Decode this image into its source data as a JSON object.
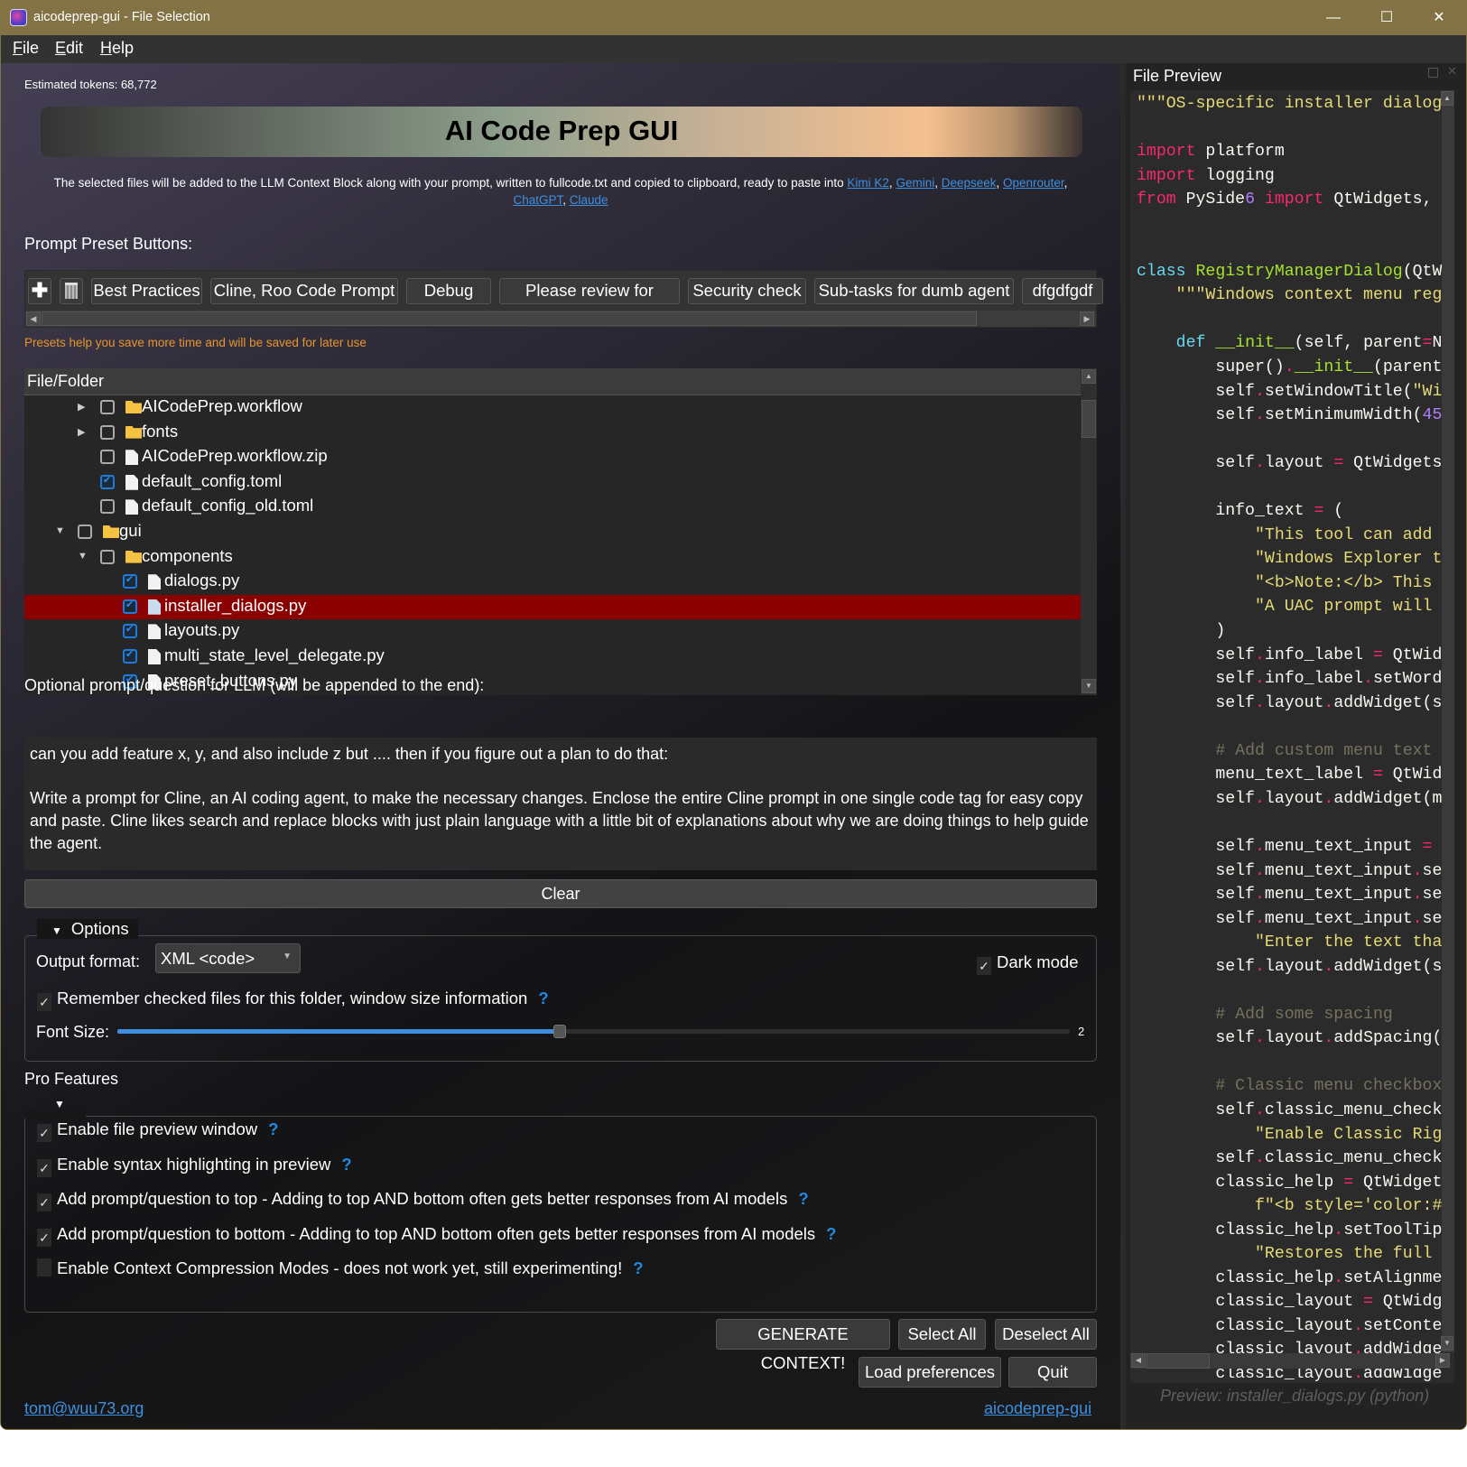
{
  "window": {
    "title": "aicodeprep-gui - File Selection",
    "controls": {
      "minimize": "—",
      "maximize": "☐",
      "close": "✕"
    }
  },
  "menu": [
    {
      "label": "File",
      "mnemonic": "F"
    },
    {
      "label": "Edit",
      "mnemonic": "E"
    },
    {
      "label": "Help",
      "mnemonic": "H"
    }
  ],
  "tokens": "Estimated tokens: 68,772",
  "banner": {
    "title": "AI Code Prep GUI"
  },
  "description": {
    "text": "The selected files will be added to the LLM Context Block along with your prompt, written to fullcode.txt and copied to clipboard, ready to paste into ",
    "links": [
      "Kimi K2",
      "Gemini",
      "Deepseek",
      "Openrouter",
      "ChatGPT",
      "Claude"
    ]
  },
  "presets": {
    "label": "Prompt Preset Buttons:",
    "add_icon": "plus-icon",
    "delete_icon": "trash-icon",
    "buttons": [
      "Best Practices",
      "Cline, Roo Code Prompt",
      "Debug",
      "Please review for",
      "Security check",
      "Sub-tasks for dumb agent",
      "dfgdfgdf"
    ],
    "note": "Presets help you save more time and will be saved for later use"
  },
  "tree": {
    "header": "File/Folder",
    "rows": [
      {
        "name": "AICodePrep.workflow",
        "type": "folder",
        "checked": false,
        "expand": "collapsed",
        "level": 1
      },
      {
        "name": "fonts",
        "type": "folder",
        "checked": false,
        "expand": "collapsed",
        "level": 1
      },
      {
        "name": "AICodePrep.workflow.zip",
        "type": "file",
        "checked": false,
        "level": 1
      },
      {
        "name": "default_config.toml",
        "type": "file",
        "checked": true,
        "level": 1
      },
      {
        "name": "default_config_old.toml",
        "type": "file",
        "checked": false,
        "level": 1
      },
      {
        "name": "gui",
        "type": "folder",
        "checked": false,
        "expand": "expanded",
        "level": 0
      },
      {
        "name": "components",
        "type": "folder",
        "checked": false,
        "expand": "expanded",
        "level": 1
      },
      {
        "name": "dialogs.py",
        "type": "file",
        "checked": true,
        "level": 2
      },
      {
        "name": "installer_dialogs.py",
        "type": "file",
        "checked": true,
        "level": 2,
        "selected": true
      },
      {
        "name": "layouts.py",
        "type": "file",
        "checked": true,
        "level": 2
      },
      {
        "name": "multi_state_level_delegate.py",
        "type": "file",
        "checked": true,
        "level": 2
      },
      {
        "name": "preset_buttons.py",
        "type": "file",
        "checked": true,
        "level": 2
      }
    ]
  },
  "prompt": {
    "label": "Optional prompt/question for LLM (will be appended to the end):",
    "paragraphs": [
      "can you add feature x, y, and also include z but .... then if you figure out a plan to do that:",
      "Write a prompt for Cline, an AI coding agent, to make the necessary changes. Enclose the entire Cline prompt in one single code tag for easy copy and paste. Cline likes search and replace blocks with just plain language with a little bit of explanations about why we are doing things to help guide the agent."
    ],
    "clear": "Clear"
  },
  "options": {
    "title": "Options",
    "output_format_label": "Output format:",
    "output_format_value": "XML <code>",
    "dark_mode": {
      "label": "Dark mode",
      "checked": true
    },
    "remember": {
      "label": "Remember checked files for this folder, window size information",
      "checked": true,
      "help": "?"
    },
    "font_size_label": "Font Size:",
    "font_size_value": "2",
    "font_slider_fraction": 0.46
  },
  "pro": {
    "title": "Pro Features",
    "items": [
      {
        "label": "Enable file preview window",
        "checked": true,
        "help": "?"
      },
      {
        "label": "Enable syntax highlighting in preview",
        "checked": true,
        "help": "?"
      },
      {
        "label": "Add prompt/question to top - Adding to top AND bottom often gets better responses from AI models",
        "checked": true,
        "help": "?"
      },
      {
        "label": "Add prompt/question to bottom - Adding to top AND bottom often gets better responses from AI models",
        "checked": true,
        "help": "?"
      },
      {
        "label": "Enable Context Compression Modes - does not work yet, still experimenting!",
        "checked": false,
        "help": "?"
      }
    ]
  },
  "actions": {
    "generate": "GENERATE CONTEXT!",
    "select_all": "Select All",
    "deselect_all": "Deselect All",
    "load_prefs": "Load preferences",
    "quit": "Quit"
  },
  "footer": {
    "email": "tom@wuu73.org",
    "project": "aicodeprep-gui"
  },
  "preview": {
    "title": "File Preview",
    "status": "Preview: installer_dialogs.py (python)",
    "lines": [
      "\"\"\"OS-specific installer dialog",
      "",
      "import platform",
      "import logging",
      "from PySide6 import QtWidgets, ",
      "",
      "",
      "class RegistryManagerDialog(QtW",
      "    \"\"\"Windows context menu reg",
      "",
      "    def __init__(self, parent=N",
      "        super().__init__(parent",
      "        self.setWindowTitle(\"Wi",
      "        self.setMinimumWidth(45",
      "",
      "        self.layout = QtWidgets",
      "",
      "        info_text = (",
      "            \"This tool can add ",
      "            \"Windows Explorer t",
      "            \"<b>Note:</b> This ",
      "            \"A UAC prompt will ",
      "        )",
      "        self.info_label = QtWid",
      "        self.info_label.setWord",
      "        self.layout.addWidget(s",
      "",
      "        # Add custom menu text",
      "        menu_text_label = QtWid",
      "        self.layout.addWidget(m",
      "",
      "        self.menu_text_input = ",
      "        self.menu_text_input.se",
      "        self.menu_text_input.se",
      "        self.menu_text_input.se",
      "            \"Enter the text tha",
      "        self.layout.addWidget(s",
      "",
      "        # Add some spacing",
      "        self.layout.addSpacing(",
      "",
      "        # Classic menu checkbox",
      "        self.classic_menu_check",
      "            \"Enable Classic Rig",
      "        self.classic_menu_check",
      "        classic_help = QtWidget",
      "            f\"<b style='color:#",
      "        classic_help.setToolTip",
      "            \"Restores the full ",
      "        classic_help.setAlignme",
      "        classic_layout = QtWidg",
      "        classic_layout.setConte",
      "        classic_layout.addWidge",
      "        classic_layout.addWidge"
    ]
  },
  "colors": {
    "titlebar": "#837344",
    "selection": "#8b0000",
    "accent": "#1f7bd8",
    "note": "#e8952c",
    "link": "#3d8fe0"
  }
}
